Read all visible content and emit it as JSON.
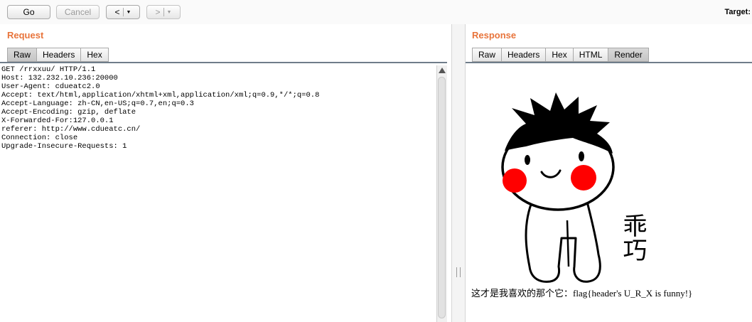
{
  "toolbar": {
    "go_label": "Go",
    "cancel_label": "Cancel",
    "back_label": "<",
    "forward_label": ">",
    "target_label": "Target:"
  },
  "request": {
    "title": "Request",
    "tabs": [
      "Raw",
      "Headers",
      "Hex"
    ],
    "active_tab": "Raw",
    "raw_text": "GET /rrxxuu/ HTTP/1.1\nHost: 132.232.10.236:20000\nUser-Agent: cdueatc2.0\nAccept: text/html,application/xhtml+xml,application/xml;q=0.9,*/*;q=0.8\nAccept-Language: zh-CN,en-US;q=0.7,en;q=0.3\nAccept-Encoding: gzip, deflate\nX-Forwarded-For:127.0.0.1\nreferer: http://www.cdueatc.cn/\nConnection: close\nUpgrade-Insecure-Requests: 1"
  },
  "response": {
    "title": "Response",
    "tabs": [
      "Raw",
      "Headers",
      "Hex",
      "HTML",
      "Render"
    ],
    "active_tab": "Render",
    "image_text": "乖巧",
    "rendered_text": "这才是我喜欢的那个它：flag{header's U_R_X is funny!}"
  },
  "colors": {
    "accent": "#e8743b",
    "cheek": "#ff0000"
  }
}
